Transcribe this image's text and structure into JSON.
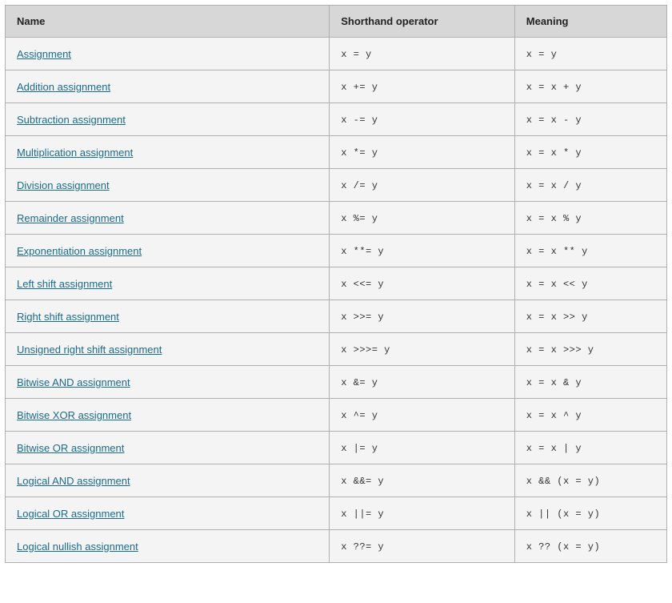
{
  "headers": {
    "name": "Name",
    "shorthand": "Shorthand operator",
    "meaning": "Meaning"
  },
  "rows": [
    {
      "name": "Assignment",
      "shorthand": "x = y",
      "meaning": "x = y"
    },
    {
      "name": "Addition assignment",
      "shorthand": "x += y",
      "meaning": "x = x + y"
    },
    {
      "name": "Subtraction assignment",
      "shorthand": "x -= y",
      "meaning": "x = x - y"
    },
    {
      "name": "Multiplication assignment",
      "shorthand": "x *= y",
      "meaning": "x = x * y"
    },
    {
      "name": "Division assignment",
      "shorthand": "x /= y",
      "meaning": "x = x / y"
    },
    {
      "name": "Remainder assignment",
      "shorthand": "x %= y",
      "meaning": "x = x % y"
    },
    {
      "name": "Exponentiation assignment",
      "shorthand": "x **= y",
      "meaning": "x = x ** y"
    },
    {
      "name": "Left shift assignment",
      "shorthand": "x <<= y",
      "meaning": "x = x << y"
    },
    {
      "name": "Right shift assignment",
      "shorthand": "x >>= y",
      "meaning": "x = x >> y"
    },
    {
      "name": "Unsigned right shift assignment",
      "shorthand": "x >>>= y",
      "meaning": "x = x >>> y"
    },
    {
      "name": "Bitwise AND assignment",
      "shorthand": "x &= y",
      "meaning": "x = x & y"
    },
    {
      "name": "Bitwise XOR assignment",
      "shorthand": "x ^= y",
      "meaning": "x = x ^ y"
    },
    {
      "name": "Bitwise OR assignment",
      "shorthand": "x |= y",
      "meaning": "x = x | y"
    },
    {
      "name": "Logical AND assignment",
      "shorthand": "x &&= y",
      "meaning": "x && (x = y)"
    },
    {
      "name": "Logical OR assignment",
      "shorthand": "x ||= y",
      "meaning": "x || (x = y)"
    },
    {
      "name": "Logical nullish assignment",
      "shorthand": "x ??= y",
      "meaning": "x ?? (x = y)"
    }
  ]
}
